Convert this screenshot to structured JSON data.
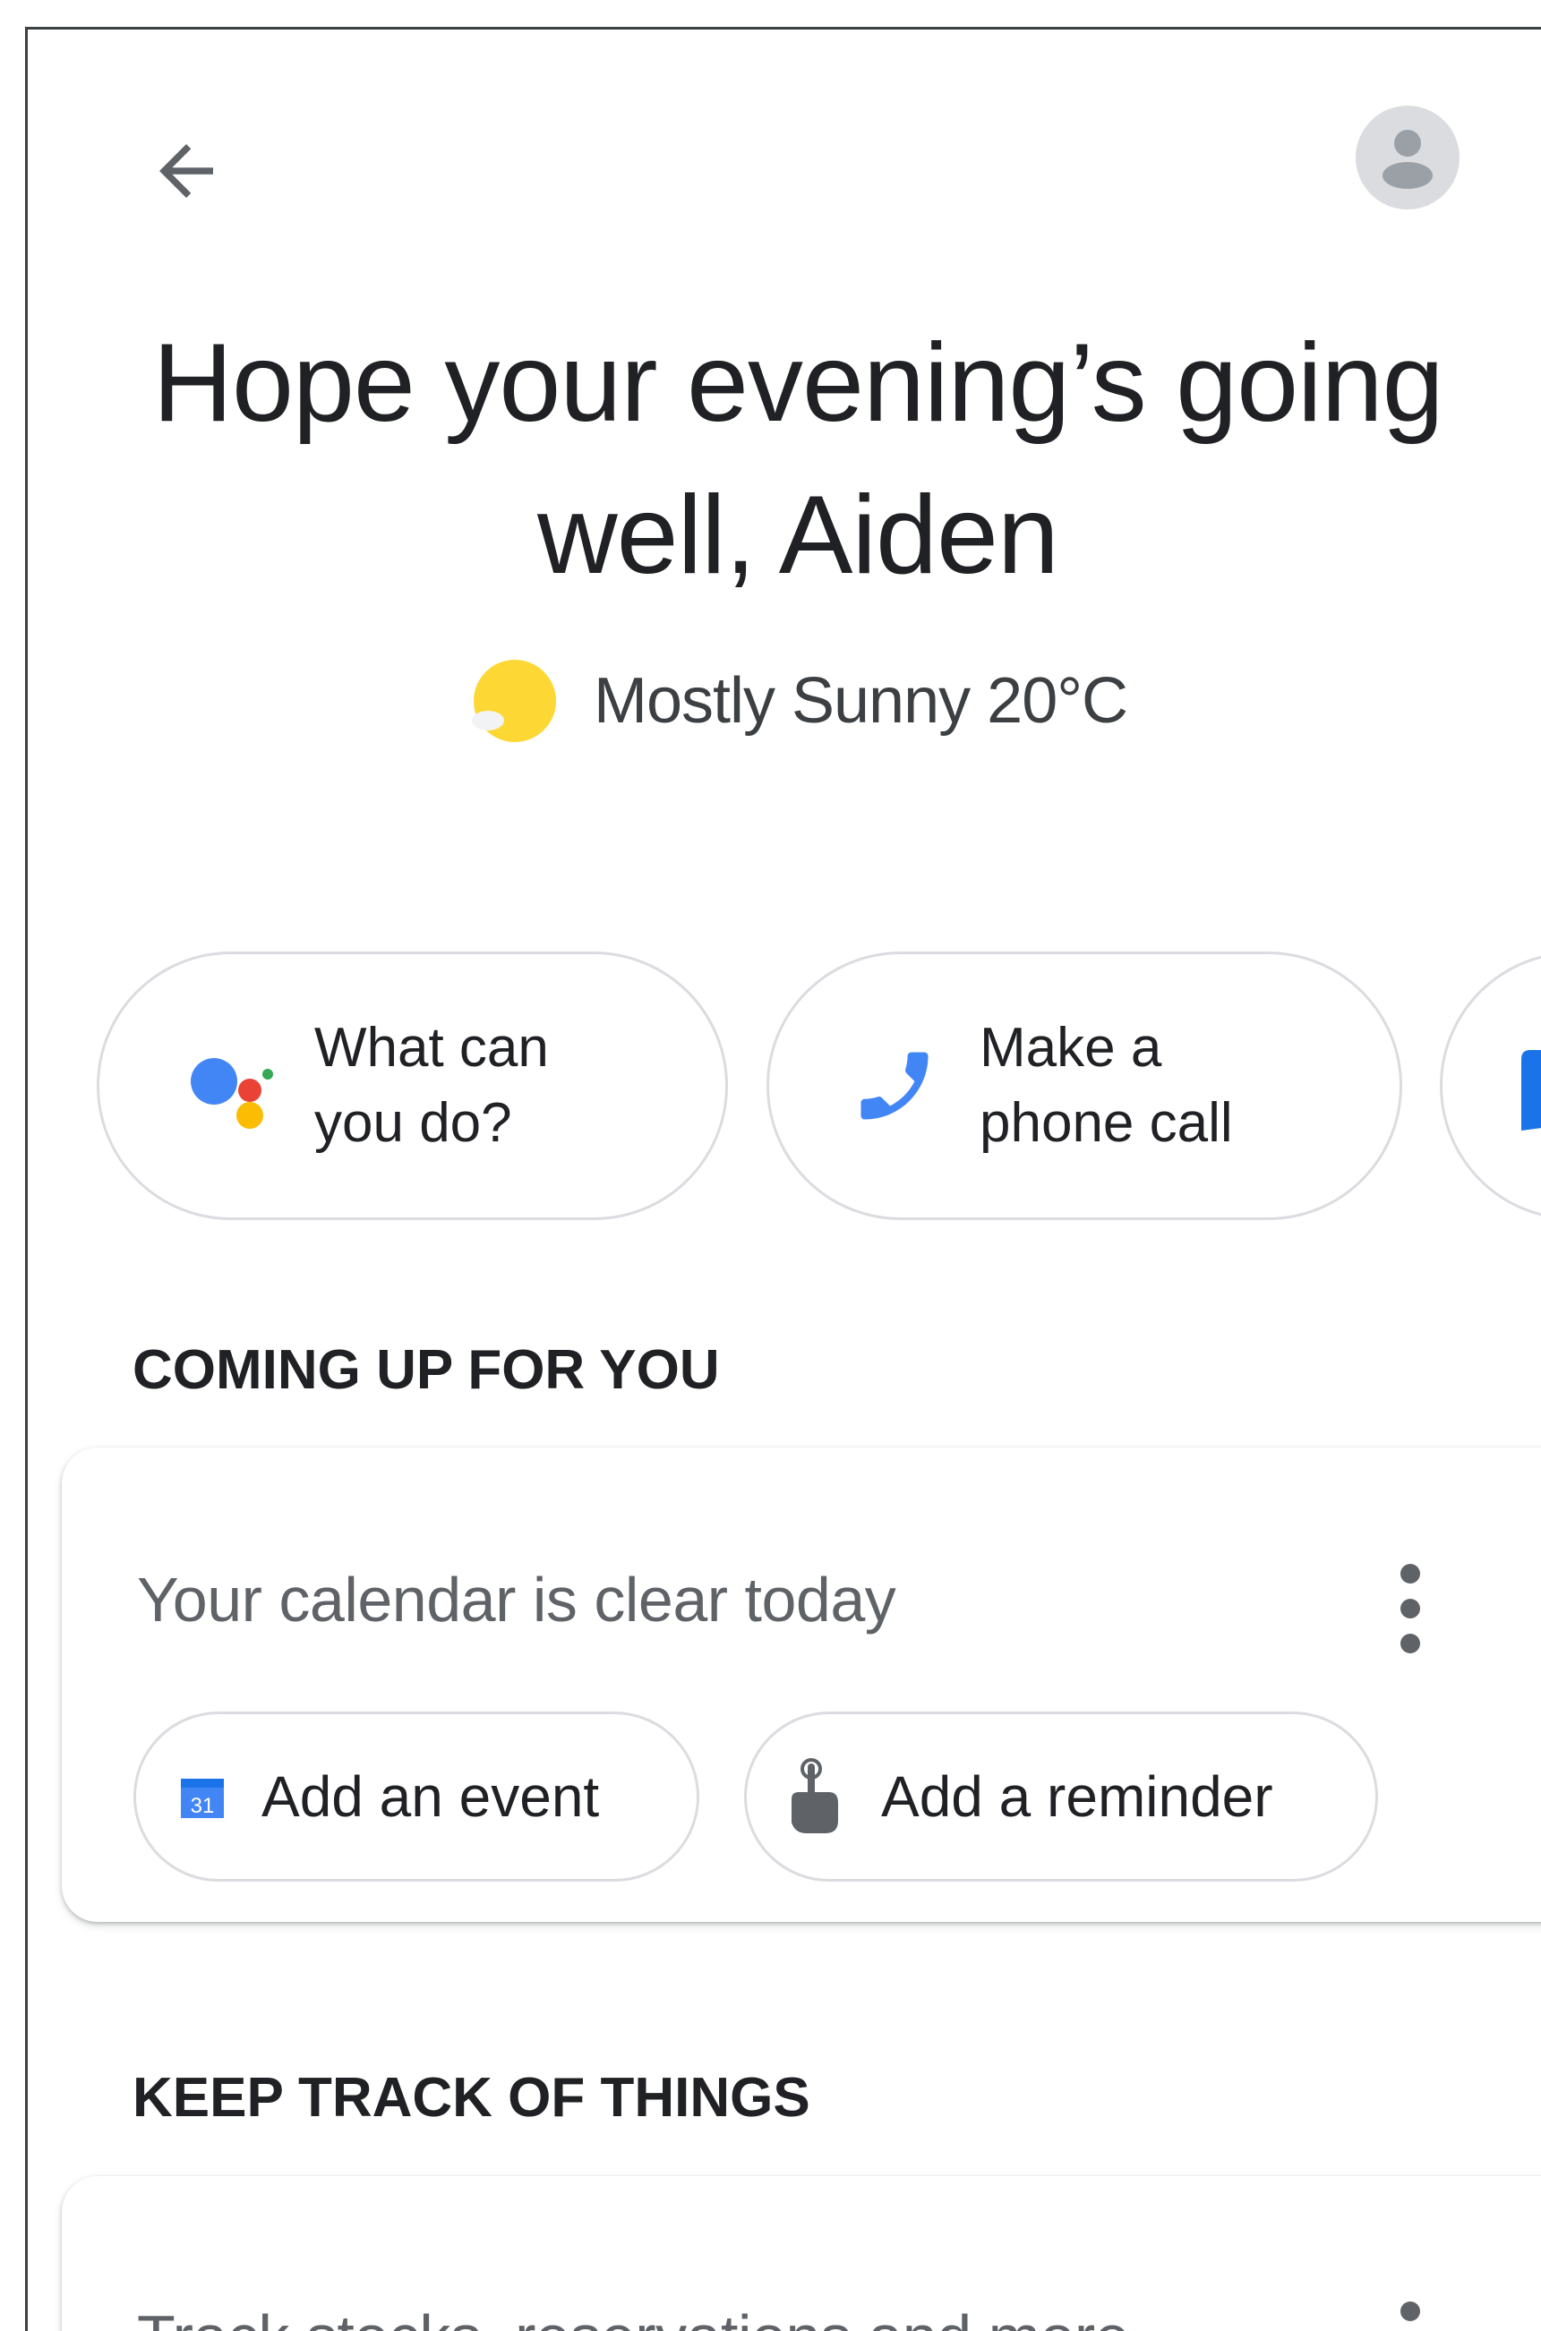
{
  "header": {
    "back_icon": "arrow-back-icon",
    "avatar_icon": "account-avatar-icon"
  },
  "greeting": {
    "line1": "Hope your evening’s going",
    "line2": "well, Aiden"
  },
  "weather": {
    "icon": "sun-icon",
    "text": "Mostly Sunny 20°C"
  },
  "suggestions": [
    {
      "label": "What can\nyou do?",
      "icon": "google-assistant-icon"
    },
    {
      "label": "Make a\nphone call",
      "icon": "phone-icon"
    },
    {
      "label": "",
      "icon": "message-icon"
    }
  ],
  "coming_up": {
    "section_title": "COMING UP FOR YOU",
    "card_title": "Your calendar is clear today",
    "actions": [
      {
        "label": "Add an event",
        "icon": "calendar-icon",
        "icon_text": "31"
      },
      {
        "label": "Add a reminder",
        "icon": "reminder-hand-icon"
      }
    ]
  },
  "keep_track": {
    "section_title": "KEEP TRACK OF THINGS",
    "card_title": "Track stocks, reservations and more"
  },
  "colors": {
    "text_primary": "#202124",
    "text_secondary": "#5f6368",
    "border": "#dadce0",
    "google_blue": "#4285f4",
    "google_red": "#ea4335",
    "google_yellow": "#fbbc04",
    "google_green": "#34a853",
    "sun_yellow": "#fdd835"
  }
}
